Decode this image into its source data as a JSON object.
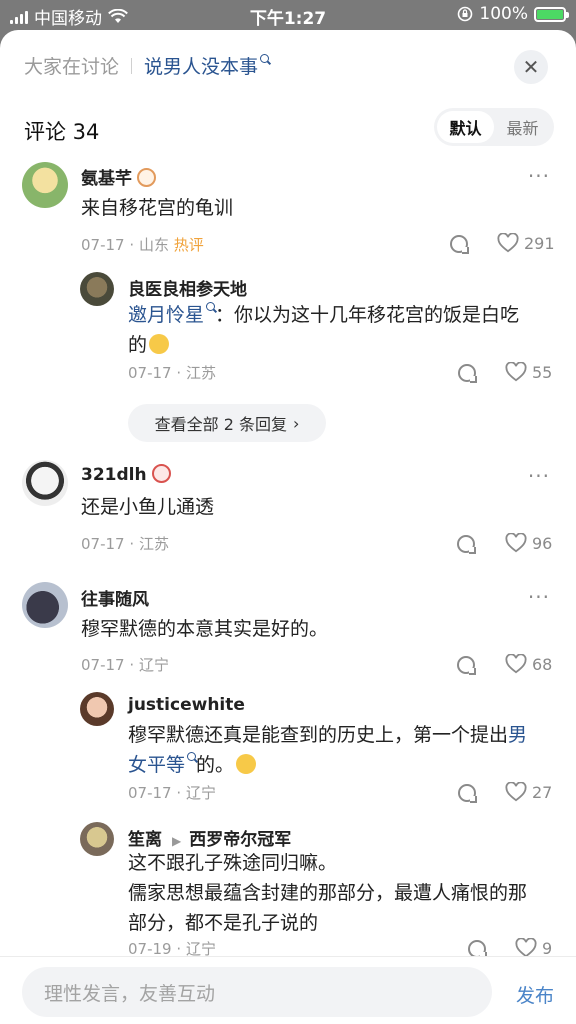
{
  "status_bar": {
    "carrier": "中国移动",
    "time": "下午1:27",
    "battery": "100%"
  },
  "topic_bar": {
    "prefix": "大家在讨论",
    "topic": "说男人没本事"
  },
  "comments_header": {
    "title": "评论 34",
    "sort_default": "默认",
    "sort_latest": "最新"
  },
  "comments": [
    {
      "name": "氨基芊",
      "content": "来自移花宫的龟训",
      "date": "07-17",
      "location": "山东",
      "hot": "热评",
      "likes": "291"
    },
    {
      "reply": true,
      "name": "良医良相参天地",
      "mention": "邀月怜星",
      "content_a": "：你以为这十几年移花宫的饭是白吃",
      "content_b": "的",
      "date": "07-17",
      "location": "江苏",
      "likes": "55"
    },
    {
      "name": "321dlh",
      "content": "还是小鱼儿通透",
      "date": "07-17",
      "location": "江苏",
      "likes": "96"
    },
    {
      "name": "往事随风",
      "content": "穆罕默德的本意其实是好的。",
      "date": "07-17",
      "location": "辽宁",
      "likes": "68"
    },
    {
      "reply": true,
      "name": "justicewhite",
      "content_a": "穆罕默德还真是能查到的历史上，第一个提出",
      "mention_a": "男",
      "mention_b": "女平等",
      "content_b": "的。",
      "date": "07-17",
      "location": "辽宁",
      "likes": "27"
    },
    {
      "reply": true,
      "name": "笙离",
      "reply_to": "西罗帝尔冠军",
      "line1": "这不跟孔子殊途同归嘛。",
      "line2": "儒家思想最蕴含封建的那部分，最遭人痛恨的那",
      "line3": "部分，都不是孔子说的",
      "date": "07-19",
      "location": "辽宁",
      "likes": "9"
    }
  ],
  "view_all_label": "查看全部 2 条回复",
  "input_placeholder": "理性发言，友善互动",
  "publish_label": "发布",
  "meta_separator": "·"
}
